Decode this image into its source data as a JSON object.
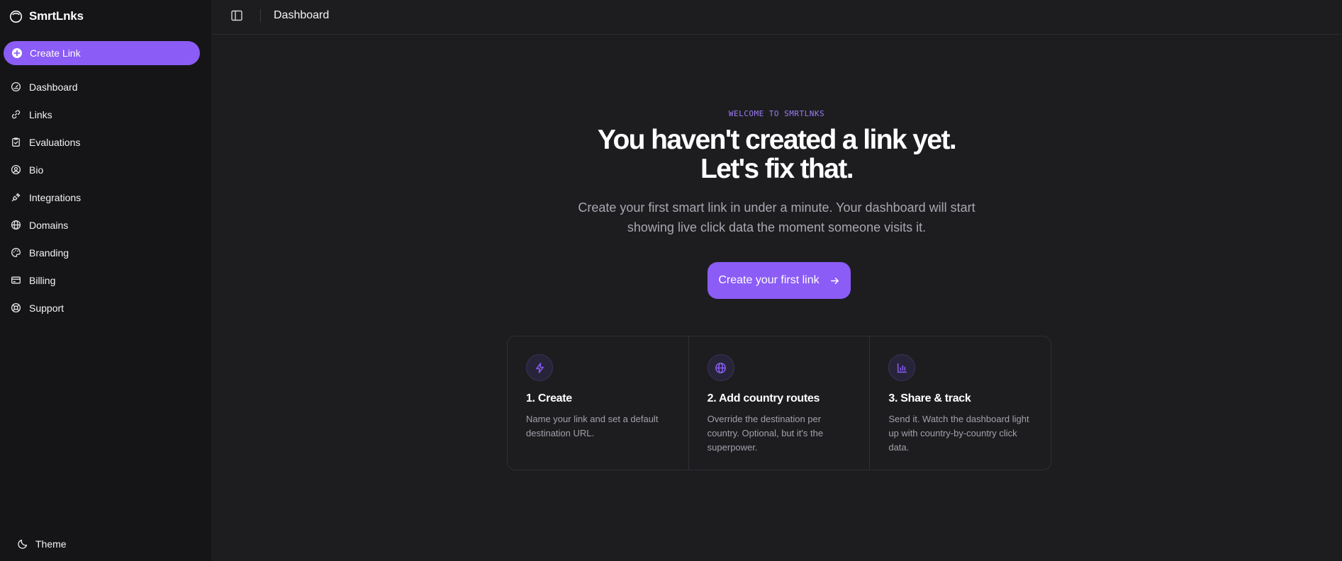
{
  "app": {
    "name": "SmrtLnks"
  },
  "sidebar": {
    "create_label": "Create Link",
    "items": [
      {
        "label": "Dashboard",
        "icon": "gauge-icon"
      },
      {
        "label": "Links",
        "icon": "link-icon"
      },
      {
        "label": "Evaluations",
        "icon": "clipboard-check-icon"
      },
      {
        "label": "Bio",
        "icon": "user-circle-icon"
      },
      {
        "label": "Integrations",
        "icon": "plug-icon"
      },
      {
        "label": "Domains",
        "icon": "globe-icon"
      },
      {
        "label": "Branding",
        "icon": "palette-icon"
      },
      {
        "label": "Billing",
        "icon": "credit-card-icon"
      },
      {
        "label": "Support",
        "icon": "life-buoy-icon"
      }
    ],
    "theme_label": "Theme"
  },
  "header": {
    "title": "Dashboard"
  },
  "main": {
    "eyebrow": "WELCOME TO SMRTLNKS",
    "headline_line1": "You haven't created a link yet.",
    "headline_line2": "Let's fix that.",
    "subtitle": "Create your first smart link in under a minute. Your dashboard will start showing live click data the moment someone visits it.",
    "cta_label": "Create your first link",
    "steps": [
      {
        "title": "1. Create",
        "desc": "Name your link and set a default destination URL.",
        "icon": "lightning-icon"
      },
      {
        "title": "2. Add country routes",
        "desc": "Override the destination per country. Optional, but it's the superpower.",
        "icon": "globe-icon"
      },
      {
        "title": "3. Share & track",
        "desc": "Send it. Watch the dashboard light up with country-by-country click data.",
        "icon": "bar-chart-icon"
      }
    ]
  },
  "colors": {
    "accent": "#8b5cf6",
    "background": "#1d1d20",
    "sidebar": "#151517"
  }
}
